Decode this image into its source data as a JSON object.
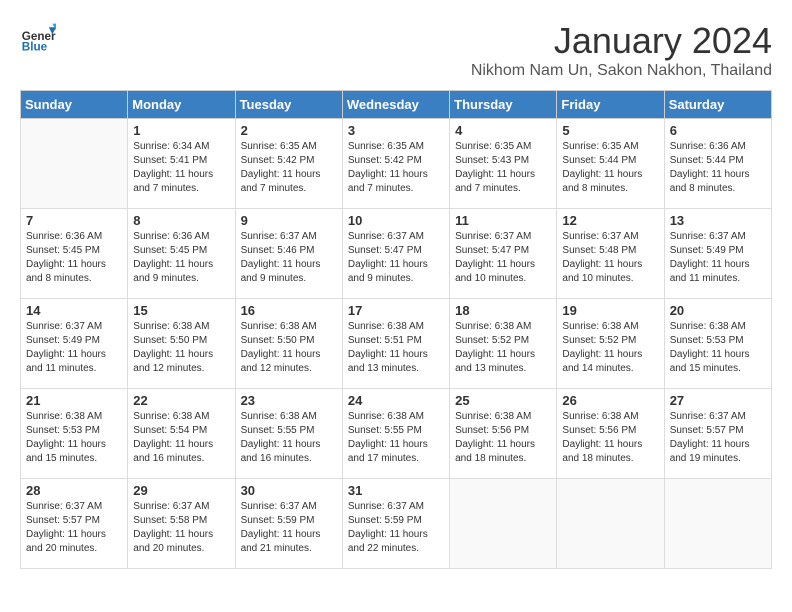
{
  "logo": {
    "line1": "General",
    "line2": "Blue"
  },
  "header": {
    "month": "January 2024",
    "location": "Nikhom Nam Un, Sakon Nakhon, Thailand"
  },
  "weekdays": [
    "Sunday",
    "Monday",
    "Tuesday",
    "Wednesday",
    "Thursday",
    "Friday",
    "Saturday"
  ],
  "weeks": [
    [
      {
        "day": "",
        "empty": true
      },
      {
        "day": "1",
        "sunrise": "6:34 AM",
        "sunset": "5:41 PM",
        "daylight": "11 hours and 7 minutes."
      },
      {
        "day": "2",
        "sunrise": "6:35 AM",
        "sunset": "5:42 PM",
        "daylight": "11 hours and 7 minutes."
      },
      {
        "day": "3",
        "sunrise": "6:35 AM",
        "sunset": "5:42 PM",
        "daylight": "11 hours and 7 minutes."
      },
      {
        "day": "4",
        "sunrise": "6:35 AM",
        "sunset": "5:43 PM",
        "daylight": "11 hours and 7 minutes."
      },
      {
        "day": "5",
        "sunrise": "6:35 AM",
        "sunset": "5:44 PM",
        "daylight": "11 hours and 8 minutes."
      },
      {
        "day": "6",
        "sunrise": "6:36 AM",
        "sunset": "5:44 PM",
        "daylight": "11 hours and 8 minutes."
      }
    ],
    [
      {
        "day": "7",
        "sunrise": "6:36 AM",
        "sunset": "5:45 PM",
        "daylight": "11 hours and 8 minutes."
      },
      {
        "day": "8",
        "sunrise": "6:36 AM",
        "sunset": "5:45 PM",
        "daylight": "11 hours and 9 minutes."
      },
      {
        "day": "9",
        "sunrise": "6:37 AM",
        "sunset": "5:46 PM",
        "daylight": "11 hours and 9 minutes."
      },
      {
        "day": "10",
        "sunrise": "6:37 AM",
        "sunset": "5:47 PM",
        "daylight": "11 hours and 9 minutes."
      },
      {
        "day": "11",
        "sunrise": "6:37 AM",
        "sunset": "5:47 PM",
        "daylight": "11 hours and 10 minutes."
      },
      {
        "day": "12",
        "sunrise": "6:37 AM",
        "sunset": "5:48 PM",
        "daylight": "11 hours and 10 minutes."
      },
      {
        "day": "13",
        "sunrise": "6:37 AM",
        "sunset": "5:49 PM",
        "daylight": "11 hours and 11 minutes."
      }
    ],
    [
      {
        "day": "14",
        "sunrise": "6:37 AM",
        "sunset": "5:49 PM",
        "daylight": "11 hours and 11 minutes."
      },
      {
        "day": "15",
        "sunrise": "6:38 AM",
        "sunset": "5:50 PM",
        "daylight": "11 hours and 12 minutes."
      },
      {
        "day": "16",
        "sunrise": "6:38 AM",
        "sunset": "5:50 PM",
        "daylight": "11 hours and 12 minutes."
      },
      {
        "day": "17",
        "sunrise": "6:38 AM",
        "sunset": "5:51 PM",
        "daylight": "11 hours and 13 minutes."
      },
      {
        "day": "18",
        "sunrise": "6:38 AM",
        "sunset": "5:52 PM",
        "daylight": "11 hours and 13 minutes."
      },
      {
        "day": "19",
        "sunrise": "6:38 AM",
        "sunset": "5:52 PM",
        "daylight": "11 hours and 14 minutes."
      },
      {
        "day": "20",
        "sunrise": "6:38 AM",
        "sunset": "5:53 PM",
        "daylight": "11 hours and 15 minutes."
      }
    ],
    [
      {
        "day": "21",
        "sunrise": "6:38 AM",
        "sunset": "5:53 PM",
        "daylight": "11 hours and 15 minutes."
      },
      {
        "day": "22",
        "sunrise": "6:38 AM",
        "sunset": "5:54 PM",
        "daylight": "11 hours and 16 minutes."
      },
      {
        "day": "23",
        "sunrise": "6:38 AM",
        "sunset": "5:55 PM",
        "daylight": "11 hours and 16 minutes."
      },
      {
        "day": "24",
        "sunrise": "6:38 AM",
        "sunset": "5:55 PM",
        "daylight": "11 hours and 17 minutes."
      },
      {
        "day": "25",
        "sunrise": "6:38 AM",
        "sunset": "5:56 PM",
        "daylight": "11 hours and 18 minutes."
      },
      {
        "day": "26",
        "sunrise": "6:38 AM",
        "sunset": "5:56 PM",
        "daylight": "11 hours and 18 minutes."
      },
      {
        "day": "27",
        "sunrise": "6:37 AM",
        "sunset": "5:57 PM",
        "daylight": "11 hours and 19 minutes."
      }
    ],
    [
      {
        "day": "28",
        "sunrise": "6:37 AM",
        "sunset": "5:57 PM",
        "daylight": "11 hours and 20 minutes."
      },
      {
        "day": "29",
        "sunrise": "6:37 AM",
        "sunset": "5:58 PM",
        "daylight": "11 hours and 20 minutes."
      },
      {
        "day": "30",
        "sunrise": "6:37 AM",
        "sunset": "5:59 PM",
        "daylight": "11 hours and 21 minutes."
      },
      {
        "day": "31",
        "sunrise": "6:37 AM",
        "sunset": "5:59 PM",
        "daylight": "11 hours and 22 minutes."
      },
      {
        "day": "",
        "empty": true
      },
      {
        "day": "",
        "empty": true
      },
      {
        "day": "",
        "empty": true
      }
    ]
  ]
}
